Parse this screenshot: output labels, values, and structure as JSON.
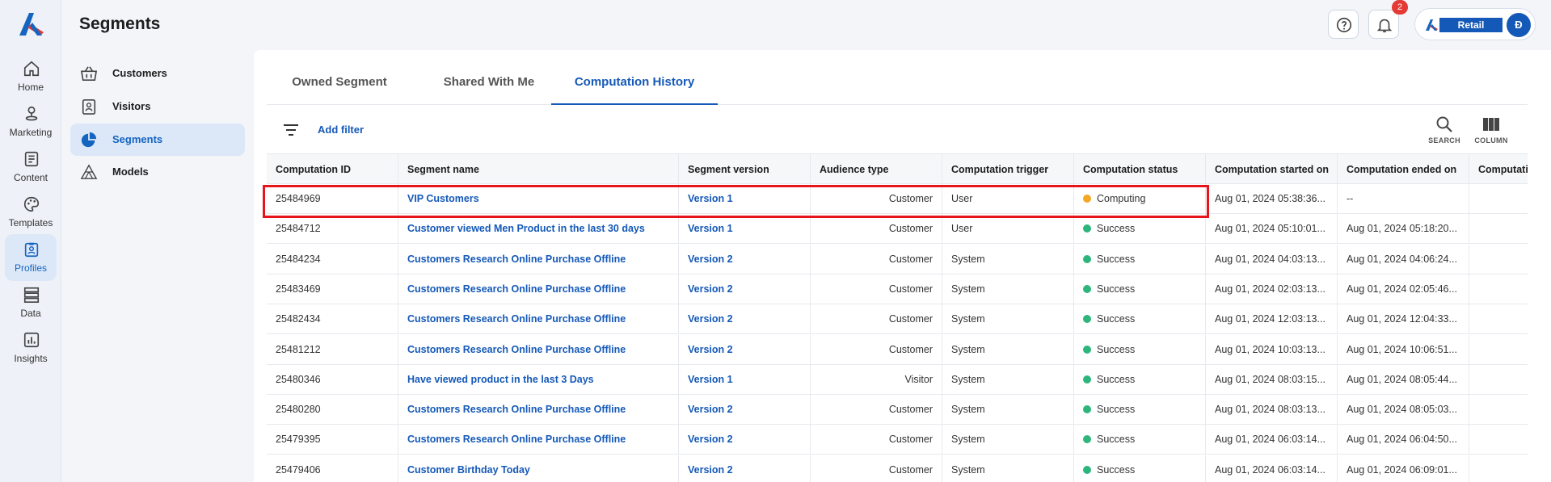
{
  "nav": {
    "items": [
      {
        "label": "Home",
        "icon": "home-icon"
      },
      {
        "label": "Marketing",
        "icon": "marketing-icon"
      },
      {
        "label": "Content",
        "icon": "content-icon"
      },
      {
        "label": "Templates",
        "icon": "palette-icon"
      },
      {
        "label": "Profiles",
        "icon": "profile-badge-icon",
        "active": true
      },
      {
        "label": "Data",
        "icon": "database-icon"
      },
      {
        "label": "Insights",
        "icon": "chart-icon"
      }
    ]
  },
  "page": {
    "title": "Segments"
  },
  "sidebar": {
    "items": [
      {
        "label": "Customers",
        "icon": "basket-icon"
      },
      {
        "label": "Visitors",
        "icon": "visitor-icon"
      },
      {
        "label": "Segments",
        "icon": "pie-icon",
        "active": true
      },
      {
        "label": "Models",
        "icon": "models-icon"
      }
    ]
  },
  "header": {
    "notification_count": "2",
    "account_tag": "Retail",
    "avatar_initial": "Đ"
  },
  "tabs": [
    {
      "label": "Owned Segment"
    },
    {
      "label": "Shared With Me"
    },
    {
      "label": "Computation History",
      "active": true
    }
  ],
  "toolbar": {
    "add_filter": "Add filter",
    "search_label": "SEARCH",
    "column_label": "COLUMN"
  },
  "colors": {
    "accent": "#1559b8",
    "computing": "#f5a623",
    "success": "#2db67c",
    "highlight": "#e8141b"
  },
  "table": {
    "columns": [
      "Computation ID",
      "Segment name",
      "Segment version",
      "Audience type",
      "Computation trigger",
      "Computation status",
      "Computation started on",
      "Computation ended on",
      "Computati"
    ],
    "rows": [
      {
        "id": "25484969",
        "name": "VIP Customers",
        "version": "Version 1",
        "audience": "Customer",
        "trigger": "User",
        "status": "Computing",
        "started": "Aug 01, 2024 05:38:36...",
        "ended": "--"
      },
      {
        "id": "25484712",
        "name": "Customer viewed Men Product in the last 30 days",
        "version": "Version 1",
        "audience": "Customer",
        "trigger": "User",
        "status": "Success",
        "started": "Aug 01, 2024 05:10:01...",
        "ended": "Aug 01, 2024 05:18:20..."
      },
      {
        "id": "25484234",
        "name": "Customers Research Online Purchase Offline",
        "version": "Version 2",
        "audience": "Customer",
        "trigger": "System",
        "status": "Success",
        "started": "Aug 01, 2024 04:03:13...",
        "ended": "Aug 01, 2024 04:06:24..."
      },
      {
        "id": "25483469",
        "name": "Customers Research Online Purchase Offline",
        "version": "Version 2",
        "audience": "Customer",
        "trigger": "System",
        "status": "Success",
        "started": "Aug 01, 2024 02:03:13...",
        "ended": "Aug 01, 2024 02:05:46..."
      },
      {
        "id": "25482434",
        "name": "Customers Research Online Purchase Offline",
        "version": "Version 2",
        "audience": "Customer",
        "trigger": "System",
        "status": "Success",
        "started": "Aug 01, 2024 12:03:13...",
        "ended": "Aug 01, 2024 12:04:33..."
      },
      {
        "id": "25481212",
        "name": "Customers Research Online Purchase Offline",
        "version": "Version 2",
        "audience": "Customer",
        "trigger": "System",
        "status": "Success",
        "started": "Aug 01, 2024 10:03:13...",
        "ended": "Aug 01, 2024 10:06:51..."
      },
      {
        "id": "25480346",
        "name": "Have viewed product in the last 3 Days",
        "version": "Version 1",
        "audience": "Visitor",
        "trigger": "System",
        "status": "Success",
        "started": "Aug 01, 2024 08:03:15...",
        "ended": "Aug 01, 2024 08:05:44..."
      },
      {
        "id": "25480280",
        "name": "Customers Research Online Purchase Offline",
        "version": "Version 2",
        "audience": "Customer",
        "trigger": "System",
        "status": "Success",
        "started": "Aug 01, 2024 08:03:13...",
        "ended": "Aug 01, 2024 08:05:03..."
      },
      {
        "id": "25479395",
        "name": "Customers Research Online Purchase Offline",
        "version": "Version 2",
        "audience": "Customer",
        "trigger": "System",
        "status": "Success",
        "started": "Aug 01, 2024 06:03:14...",
        "ended": "Aug 01, 2024 06:04:50..."
      },
      {
        "id": "25479406",
        "name": "Customer Birthday Today",
        "version": "Version 2",
        "audience": "Customer",
        "trigger": "System",
        "status": "Success",
        "started": "Aug 01, 2024 06:03:14...",
        "ended": "Aug 01, 2024 06:09:01..."
      }
    ]
  }
}
